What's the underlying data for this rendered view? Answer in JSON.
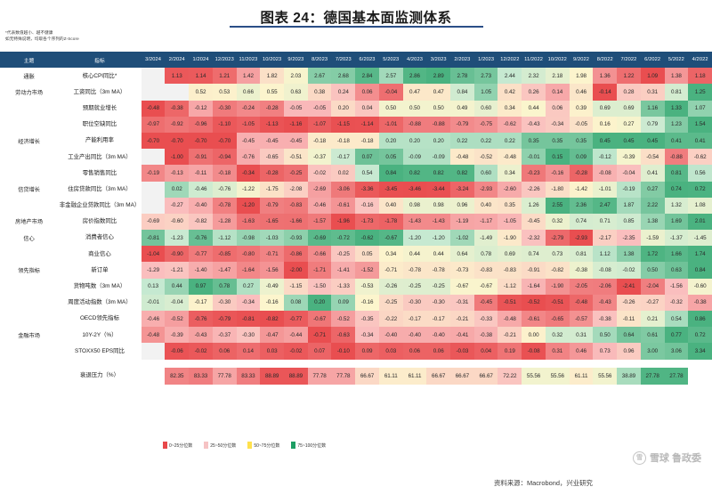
{
  "title": "图表 24：德国基本面监测体系",
  "note": "*代表数值越小、越不健康\n如无特殊说明，均取各个序列的Z-Score",
  "source": "资料来源：Macrobond，兴业研究",
  "watermark": {
    "mark": "雪",
    "text": "雪球 鲁政委"
  },
  "table": {
    "head": {
      "theme": "主题",
      "indicator": "指标"
    },
    "dates": [
      "3/2024",
      "2/2024",
      "1/2024",
      "12/2023",
      "11/2023",
      "10/2023",
      "9/2023",
      "8/2023",
      "7/2023",
      "6/2023",
      "5/2023",
      "4/2023",
      "3/2023",
      "2/2023",
      "1/2023",
      "12/2022",
      "11/2022",
      "10/2022",
      "9/2022",
      "8/2022",
      "7/2022",
      "6/2022",
      "5/2022",
      "4/2022"
    ],
    "rows": [
      {
        "theme": "通胀",
        "indicator": "核心CPI同比*",
        "values": [
          null,
          1.13,
          1.14,
          1.21,
          1.42,
          1.82,
          2.03,
          2.67,
          2.68,
          2.84,
          2.57,
          2.86,
          2.89,
          2.78,
          2.73,
          2.44,
          2.32,
          2.18,
          1.98,
          1.36,
          1.22,
          1.09,
          1.38,
          1.18
        ]
      },
      {
        "theme": "劳动力市场",
        "indicator": "工资同比（3m MA）",
        "values": [
          null,
          null,
          0.52,
          0.53,
          0.66,
          0.55,
          0.63,
          0.38,
          0.24,
          0.06,
          -0.04,
          0.47,
          0.47,
          0.84,
          1.05,
          0.42,
          0.26,
          0.14,
          0.46,
          -0.14,
          0.28,
          0.31,
          0.81,
          1.25
        ]
      },
      {
        "theme": "",
        "indicator": "预期就业增长",
        "values": [
          -0.48,
          -0.38,
          -0.12,
          -0.3,
          -0.24,
          -0.28,
          -0.05,
          -0.05,
          0.2,
          0.04,
          0.5,
          0.5,
          0.5,
          0.49,
          0.6,
          0.34,
          0.44,
          0.06,
          0.39,
          0.69,
          0.69,
          1.16,
          1.33,
          1.07
        ]
      },
      {
        "theme": "",
        "indicator": "职位空缺同比",
        "values": [
          -0.97,
          -0.92,
          -0.96,
          -1.1,
          -1.05,
          -1.13,
          -1.16,
          -1.07,
          -1.15,
          -1.14,
          -1.01,
          -0.88,
          -0.88,
          -0.79,
          -0.75,
          -0.62,
          -0.43,
          -0.34,
          -0.05,
          0.16,
          0.27,
          0.79,
          1.23,
          1.54
        ]
      },
      {
        "theme": "经济增长",
        "indicator": "产能利用率",
        "values": [
          -0.7,
          -0.7,
          -0.7,
          -0.7,
          -0.45,
          -0.45,
          -0.45,
          -0.18,
          -0.18,
          -0.18,
          0.2,
          0.2,
          0.2,
          0.22,
          0.22,
          0.22,
          0.35,
          0.35,
          0.35,
          0.45,
          0.45,
          0.45,
          0.41,
          0.41,
          0.41
        ]
      },
      {
        "theme": "",
        "indicator": "工业产出同比（3m MA）",
        "values": [
          null,
          -1.0,
          -0.91,
          -0.94,
          -0.76,
          -0.65,
          -0.51,
          -0.37,
          -0.17,
          0.07,
          0.05,
          -0.09,
          -0.09,
          -0.48,
          -0.52,
          -0.48,
          -0.01,
          0.15,
          0.09,
          -0.12,
          -0.39,
          -0.54,
          -0.88,
          -0.62
        ]
      },
      {
        "theme": "",
        "indicator": "零售销售同比",
        "values": [
          -0.19,
          -0.13,
          -0.11,
          -0.18,
          -0.34,
          -0.28,
          -0.25,
          -0.02,
          0.02,
          0.54,
          0.84,
          0.82,
          0.82,
          0.82,
          0.6,
          0.34,
          -0.23,
          -0.16,
          -0.28,
          -0.08,
          -0.04,
          0.41,
          0.81,
          0.56
        ]
      },
      {
        "theme": "信贷增长",
        "indicator": "住房贷款同比（3m MA）",
        "values": [
          null,
          0.02,
          -0.46,
          -0.76,
          -1.22,
          -1.75,
          -2.08,
          -2.69,
          -3.06,
          -3.36,
          -3.45,
          -3.46,
          -3.44,
          -3.24,
          -2.93,
          -2.6,
          -2.26,
          -1.8,
          -1.42,
          -1.01,
          -0.19,
          0.27,
          0.74,
          0.72
        ]
      },
      {
        "theme": "",
        "indicator": "非金融企业贷款同比（3m MA）",
        "values": [
          null,
          -0.27,
          -0.4,
          -0.78,
          -1.2,
          -0.79,
          -0.83,
          -0.46,
          -0.61,
          -0.16,
          0.4,
          0.98,
          0.98,
          0.96,
          0.4,
          0.35,
          1.26,
          2.55,
          2.36,
          2.47,
          1.87,
          2.22,
          1.32,
          1.08
        ]
      },
      {
        "theme": "房地产市场",
        "indicator": "房价指数同比",
        "values": [
          -0.69,
          -0.6,
          -0.82,
          -1.28,
          -1.63,
          -1.65,
          -1.66,
          -1.57,
          -1.96,
          -1.73,
          -1.78,
          -1.43,
          -1.43,
          -1.19,
          -1.17,
          -1.05,
          -0.45,
          0.32,
          0.74,
          0.71,
          0.85,
          1.38,
          1.69,
          2.01
        ]
      },
      {
        "theme": "信心",
        "indicator": "消费者信心",
        "values": [
          -0.81,
          -1.23,
          -0.76,
          -1.12,
          -0.98,
          -1.03,
          -0.93,
          -0.69,
          -0.72,
          -0.62,
          -0.67,
          -1.2,
          -1.2,
          -1.02,
          -1.49,
          -1.9,
          -2.32,
          -2.79,
          -2.93,
          -2.17,
          -2.35,
          -1.59,
          -1.37,
          -1.45
        ]
      },
      {
        "theme": "",
        "indicator": "商业信心",
        "values": [
          -1.04,
          -0.9,
          -0.77,
          -0.85,
          -0.8,
          -0.71,
          -0.86,
          -0.66,
          -0.25,
          0.05,
          0.34,
          0.44,
          0.44,
          0.64,
          0.78,
          0.69,
          0.74,
          0.73,
          0.81,
          1.12,
          1.38,
          1.72,
          1.66,
          1.74
        ]
      },
      {
        "theme": "领先指标",
        "indicator": "新订单",
        "values": [
          -1.29,
          -1.21,
          -1.4,
          -1.47,
          -1.64,
          -1.56,
          -2.0,
          -1.71,
          -1.41,
          -1.52,
          -0.71,
          -0.78,
          -0.78,
          -0.73,
          -0.83,
          -0.83,
          -0.91,
          -0.82,
          -0.38,
          -0.08,
          -0.02,
          0.5,
          0.63,
          0.84
        ]
      },
      {
        "theme": "",
        "indicator": "货物吨数（3m MA）",
        "values": [
          0.13,
          0.44,
          0.97,
          0.78,
          0.27,
          -0.49,
          -1.15,
          -1.5,
          -1.33,
          -0.53,
          -0.26,
          -0.25,
          -0.25,
          -0.67,
          -0.67,
          -1.12,
          -1.64,
          -1.9,
          -2.05,
          -2.06,
          -2.41,
          -2.04,
          -1.56,
          -0.6
        ]
      },
      {
        "theme": "",
        "indicator": "周度活动指数（3m MA）",
        "values": [
          -0.01,
          -0.04,
          -0.17,
          -0.3,
          -0.34,
          -0.16,
          0.08,
          0.2,
          0.09,
          -0.16,
          -0.25,
          -0.3,
          -0.3,
          -0.31,
          -0.45,
          -0.51,
          -0.52,
          -0.51,
          -0.48,
          -0.43,
          -0.26,
          -0.27,
          -0.32,
          -0.38
        ]
      },
      {
        "theme": "",
        "indicator": "OECD领先指标",
        "values": [
          -0.46,
          -0.52,
          -0.76,
          -0.79,
          -0.81,
          -0.82,
          -0.77,
          -0.67,
          -0.52,
          -0.35,
          -0.22,
          -0.17,
          -0.17,
          -0.21,
          -0.33,
          -0.48,
          -0.61,
          -0.65,
          -0.57,
          -0.38,
          -0.11,
          0.21,
          0.54,
          0.86
        ]
      },
      {
        "theme": "金融市场",
        "indicator": "10Y-2Y（%）",
        "values": [
          -0.48,
          -0.39,
          -0.43,
          -0.37,
          -0.3,
          -0.47,
          -0.44,
          -0.71,
          -0.63,
          -0.34,
          -0.4,
          -0.4,
          -0.4,
          -0.41,
          -0.38,
          -0.21,
          0.0,
          0.32,
          0.31,
          0.5,
          0.64,
          0.61,
          0.77,
          0.72
        ]
      },
      {
        "theme": "",
        "indicator": "STOXX50 EPS同比",
        "values": [
          null,
          -0.06,
          -0.02,
          0.06,
          0.14,
          0.03,
          -0.02,
          0.07,
          -0.1,
          0.09,
          0.03,
          0.06,
          0.06,
          -0.03,
          0.04,
          0.19,
          -0.08,
          0.31,
          0.46,
          0.73,
          0.96,
          3.0,
          3.06,
          3.34
        ]
      }
    ],
    "bottom_row": {
      "theme": "",
      "indicator": "衰退压力（%）",
      "values": [
        null,
        82.35,
        83.33,
        77.78,
        83.33,
        88.89,
        88.89,
        77.78,
        77.78,
        66.67,
        61.11,
        61.11,
        66.67,
        66.67,
        66.67,
        72.22,
        55.56,
        55.56,
        61.11,
        55.56,
        38.89,
        27.78,
        27.78,
        null
      ]
    }
  },
  "legend": [
    {
      "label": "0~25分位数",
      "color": "#e8484a"
    },
    {
      "label": "25~50分位数",
      "color": "#f6c3c4"
    },
    {
      "label": "50~75分位数",
      "color": "#ffe14d"
    },
    {
      "label": "75~100分位数",
      "color": "#1e9e64"
    }
  ]
}
